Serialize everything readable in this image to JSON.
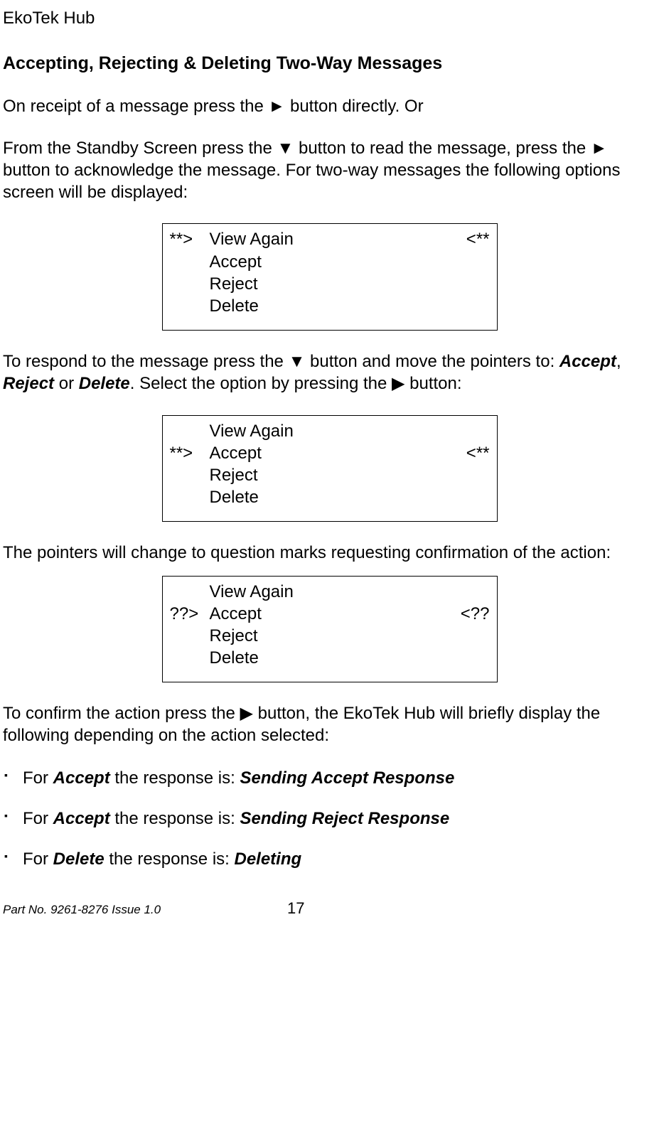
{
  "header": "EkoTek Hub",
  "section_title": "Accepting, Rejecting & Deleting Two-Way Messages",
  "p1_a": "On receipt of a message press the ",
  "p1_btn": "►",
  "p1_b": " button directly. Or",
  "p2_a": "From the Standby Screen press the ",
  "p2_btn1": "▼",
  "p2_b": " button to read the message, press the ",
  "p2_btn2": "►",
  "p2_c": " button to acknowledge the message.  For two-way messages the following options screen will be displayed:",
  "screen1": {
    "rows": [
      {
        "l": "**>",
        "m": "View Again",
        "r": "<**"
      },
      {
        "l": "",
        "m": "Accept",
        "r": ""
      },
      {
        "l": "",
        "m": "Reject",
        "r": ""
      },
      {
        "l": "",
        "m": "Delete",
        "r": ""
      }
    ]
  },
  "p3_a": "To respond to the message press the ",
  "p3_btn": "▼",
  "p3_b": " button and move the pointers to: ",
  "p3_opt1": "Accept",
  "p3_sep1": ", ",
  "p3_opt2": "Reject",
  "p3_sep2": " or ",
  "p3_opt3": "Delete",
  "p3_c": ".  Select the option by pressing the ",
  "p3_btn2": "▶",
  "p3_d": " button:",
  "screen2": {
    "rows": [
      {
        "l": "",
        "m": "View Again",
        "r": ""
      },
      {
        "l": "**>",
        "m": "Accept",
        "r": "<**"
      },
      {
        "l": "",
        "m": "Reject",
        "r": ""
      },
      {
        "l": "",
        "m": "Delete",
        "r": ""
      }
    ]
  },
  "p4": "The pointers will change to question marks requesting confirmation of the action:",
  "screen3": {
    "rows": [
      {
        "l": "",
        "m": "View Again",
        "r": ""
      },
      {
        "l": "??>",
        "m": "Accept",
        "r": "<??"
      },
      {
        "l": "",
        "m": "Reject",
        "r": ""
      },
      {
        "l": "",
        "m": "Delete",
        "r": ""
      }
    ]
  },
  "p5_a": "To confirm the action press the ",
  "p5_btn": "▶",
  "p5_b": " button, the EkoTek Hub will briefly display the following depending on the action selected:",
  "bullets": [
    {
      "a": "For ",
      "b": "Accept",
      "c": " the response is: ",
      "d": "Sending Accept Response"
    },
    {
      "a": "For ",
      "b": "Accept",
      "c": " the response is: ",
      "d": "Sending Reject Response"
    },
    {
      "a": "For ",
      "b": "Delete",
      "c": " the response is: ",
      "d": "Deleting"
    }
  ],
  "footer_left": "Part No. 9261-8276  Issue 1.0",
  "footer_page": "17"
}
